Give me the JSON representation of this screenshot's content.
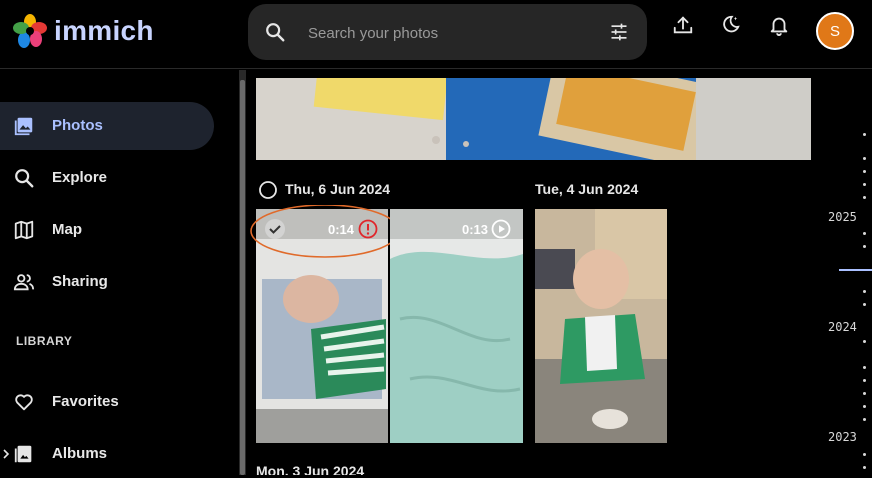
{
  "app": {
    "name": "immich"
  },
  "search": {
    "placeholder": "Search your photos"
  },
  "user": {
    "initial": "S",
    "avatar_color": "#e07818"
  },
  "sidebar": {
    "items": [
      {
        "label": "Photos",
        "icon": "photos-icon",
        "active": true
      },
      {
        "label": "Explore",
        "icon": "search-icon"
      },
      {
        "label": "Map",
        "icon": "map-icon"
      },
      {
        "label": "Sharing",
        "icon": "people-icon"
      }
    ],
    "library_heading": "LIBRARY",
    "library_items": [
      {
        "label": "Favorites",
        "icon": "heart-icon"
      },
      {
        "label": "Albums",
        "icon": "album-icon"
      }
    ]
  },
  "timeline_groups": [
    {
      "date": "Thu, 6 Jun 2024",
      "assets": [
        {
          "type": "video",
          "duration": "0:14",
          "status_icon": "error-icon"
        },
        {
          "type": "video",
          "duration": "0:13",
          "status_icon": "play-icon"
        }
      ]
    },
    {
      "date": "Tue, 4 Jun 2024",
      "assets": [
        {
          "type": "photo"
        }
      ]
    },
    {
      "date": "Mon, 3 Jun 2024",
      "assets": []
    }
  ],
  "scrubber": {
    "years": [
      "2025",
      "2024",
      "2023"
    ]
  },
  "colors": {
    "accent": "#aac0ff",
    "highlight_ring": "#e06a2a",
    "error": "#e0262b"
  }
}
